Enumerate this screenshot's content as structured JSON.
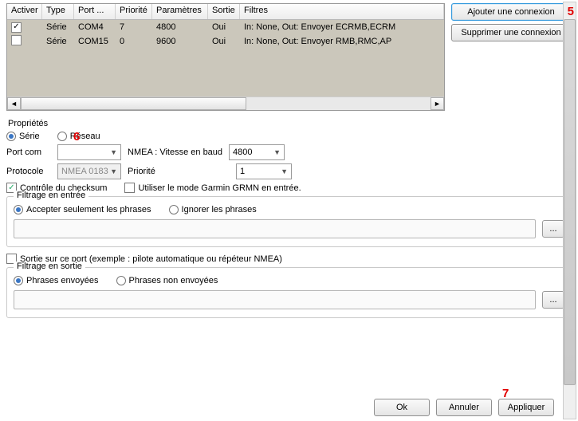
{
  "annotations": {
    "a5": "5",
    "a6": "6",
    "a7": "7"
  },
  "table": {
    "headers": [
      "Activer",
      "Type",
      "Port ...",
      "Priorité",
      "Paramètres",
      "Sortie",
      "Filtres"
    ],
    "rows": [
      {
        "active": true,
        "type": "Série",
        "port": "COM4",
        "priority": "7",
        "params": "4800",
        "output": "Oui",
        "filters": "In: None, Out: Envoyer ECRMB,ECRM"
      },
      {
        "active": false,
        "type": "Série",
        "port": "COM15",
        "priority": "0",
        "params": "9600",
        "output": "Oui",
        "filters": "In: None, Out: Envoyer RMB,RMC,AP"
      }
    ]
  },
  "buttons": {
    "add": "Ajouter une connexion",
    "delete": "Supprimer une connexion",
    "ok": "Ok",
    "cancel": "Annuler",
    "apply": "Appliquer",
    "more": "..."
  },
  "props": {
    "title": "Propriétés",
    "conn_type": {
      "serial": "Série",
      "network": "Réseau"
    },
    "port_label": "Port com",
    "port_value": "",
    "baud_label": "NMEA : Vitesse en baud",
    "baud_value": "4800",
    "protocol_label": "Protocole",
    "protocol_value": "NMEA 0183",
    "priority_label": "Priorité",
    "priority_value": "1",
    "checksum": "Contrôle du checksum",
    "garmin": "Utiliser le mode Garmin GRMN en entrée."
  },
  "input_filter": {
    "legend": "Filtrage en entrée",
    "accept": "Accepter seulement les phrases",
    "ignore": "Ignorer les phrases",
    "value": ""
  },
  "output": {
    "enable": "Sortie sur ce port (exemple : pilote automatique ou répéteur NMEA)",
    "legend": "Filtrage en sortie",
    "sent": "Phrases envoyées",
    "notsent": "Phrases non envoyées",
    "value": ""
  }
}
